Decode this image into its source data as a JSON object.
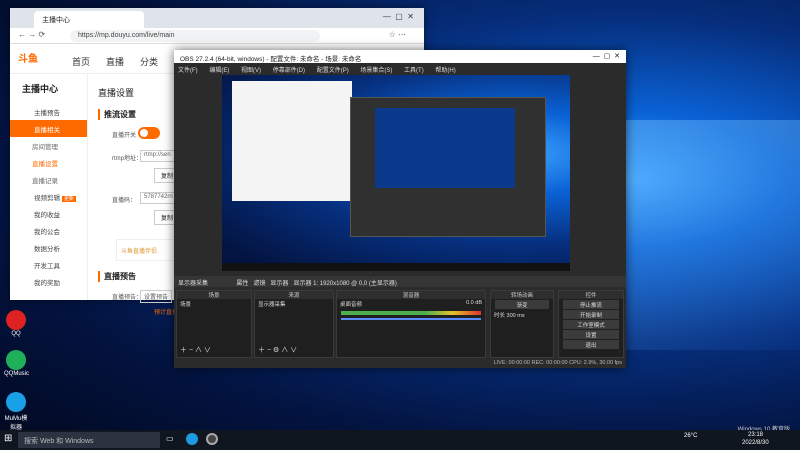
{
  "desktop": {
    "icons": [
      {
        "label": "QQ",
        "icon": "qq-icon",
        "color": "#d22"
      },
      {
        "label": "QQMusic",
        "icon": "qqmusic-icon",
        "color": "#1fb05a"
      },
      {
        "label": "MuMu模拟器",
        "icon": "mumu-icon",
        "color": "#19a0e6"
      }
    ],
    "watermark": [
      "Windows 10 教育版"
    ]
  },
  "browser": {
    "tab_title": "主播中心",
    "url": "https://mp.douyu.com/live/main",
    "site": {
      "logo_text": "斗鱼",
      "nav": [
        "首页",
        "直播",
        "分类"
      ]
    },
    "sidebar": {
      "title": "主播中心",
      "items": [
        {
          "label": "主播预告",
          "active": false
        },
        {
          "label": "直播相关",
          "active": true
        },
        {
          "label": "房间管理",
          "sub": true
        },
        {
          "label": "直播设置",
          "sub": true,
          "selected": true
        },
        {
          "label": "直播记录",
          "sub": true
        },
        {
          "label": "视频剪辑",
          "badge": "更新"
        },
        {
          "label": "我的收益"
        },
        {
          "label": "我的公会"
        },
        {
          "label": "数据分析"
        },
        {
          "label": "开发工具"
        },
        {
          "label": "我的奖励"
        }
      ]
    },
    "main": {
      "heading": "直播设置",
      "section1": "推流设置",
      "rows": [
        {
          "label": "直播开关",
          "type": "toggle"
        },
        {
          "label": "rtmp地址：",
          "value": "rtmp://sen"
        },
        {
          "label": "复制"
        },
        {
          "label": "直播码：",
          "value": "5787742rn"
        },
        {
          "label": "复制"
        }
      ],
      "promo": "斗鱼直播伴侣",
      "section2": "直播预告",
      "preview_label": "直播预告：",
      "preview_btn": "设置预告",
      "preview_link": "预计直播"
    }
  },
  "obs": {
    "title": "OBS 27.2.4 (64-bit, windows) - 配置文件: 未命名 - 场景: 未命名",
    "menu": [
      "文件(F)",
      "编辑(E)",
      "视图(V)",
      "停靠部件(D)",
      "配置文件(P)",
      "场景集合(S)",
      "工具(T)",
      "帮助(H)"
    ],
    "source_bar": "显示器采集",
    "source_bar_items": [
      "属性",
      "滤镜",
      "显示器",
      "显示器 1: 1920x1080 @ 0,0 (主显示器)"
    ],
    "docks": {
      "scenes": {
        "title": "场景",
        "items": [
          "场景"
        ]
      },
      "sources": {
        "title": "来源",
        "items": [
          "显示器采集"
        ]
      },
      "mixer": {
        "title": "混音器",
        "track": "桌面音频",
        "level": "0.0 dB"
      },
      "transitions": {
        "title": "转场动画",
        "type": "渐变",
        "duration_label": "时长",
        "duration": "300 ms"
      },
      "controls": {
        "title": "控件",
        "buttons": [
          "停止推流",
          "开始录制",
          "工作室模式",
          "设置",
          "退出"
        ]
      }
    },
    "status": "LIVE: 00:00:00   REC: 00:00:00   CPU: 2.9%, 30.00 fps"
  },
  "taskbar": {
    "search_placeholder": "搜索 Web 和 Windows",
    "temp": "26°C",
    "time": "23:18",
    "date": "2022/8/30"
  }
}
